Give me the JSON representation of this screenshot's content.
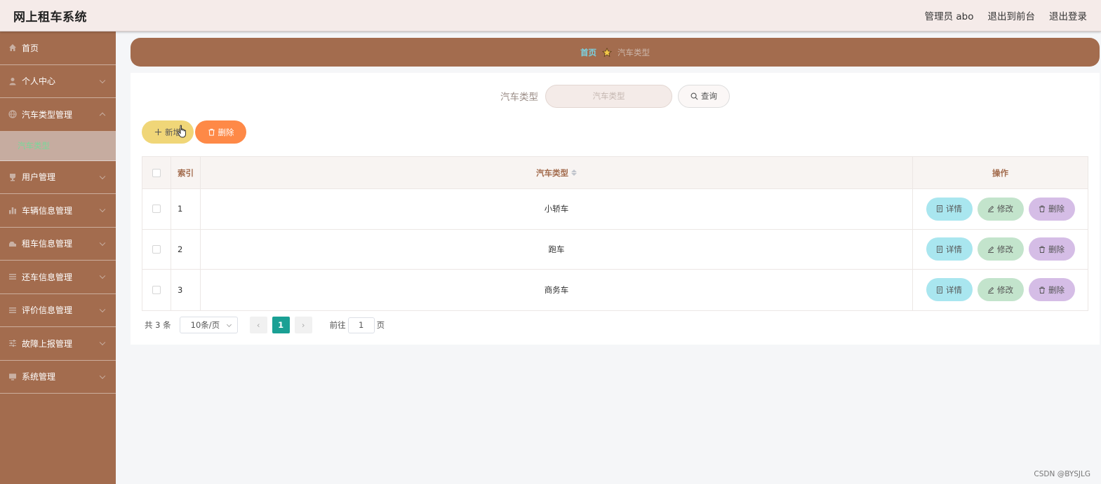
{
  "header": {
    "app_title": "网上租车系统",
    "admin_label": "管理员 abo",
    "back_to_front": "退出到前台",
    "logout": "退出登录"
  },
  "sidebar": {
    "items": [
      {
        "label": "首页",
        "icon": "home-icon"
      },
      {
        "label": "个人中心",
        "icon": "user-icon"
      },
      {
        "label": "汽车类型管理",
        "icon": "globe-icon",
        "expanded": true
      },
      {
        "label": "用户管理",
        "icon": "cup-icon"
      },
      {
        "label": "车辆信息管理",
        "icon": "bar-chart-icon"
      },
      {
        "label": "租车信息管理",
        "icon": "car-icon"
      },
      {
        "label": "还车信息管理",
        "icon": "list-icon"
      },
      {
        "label": "评价信息管理",
        "icon": "list-icon"
      },
      {
        "label": "故障上报管理",
        "icon": "sliders-icon"
      },
      {
        "label": "系统管理",
        "icon": "monitor-icon"
      }
    ],
    "subitem": "汽车类型"
  },
  "breadcrumb": {
    "home": "首页",
    "current": "汽车类型"
  },
  "search": {
    "label": "汽车类型",
    "placeholder": "汽车类型",
    "button": "查询"
  },
  "actions": {
    "add": "新增",
    "delete": "删除"
  },
  "table": {
    "headers": {
      "index": "索引",
      "type": "汽车类型",
      "ops": "操作"
    },
    "rows": [
      {
        "index": "1",
        "type": "小轿车"
      },
      {
        "index": "2",
        "type": "跑车"
      },
      {
        "index": "3",
        "type": "商务车"
      }
    ],
    "op_labels": {
      "detail": "详情",
      "edit": "修改",
      "delete": "删除"
    }
  },
  "pagination": {
    "total": "共 3 条",
    "page_size": "10条/页",
    "current_page": "1",
    "goto_label": "前往",
    "goto_value": "1",
    "page_suffix": "页",
    "prev": "‹",
    "next": "›"
  },
  "watermark": "CSDN @BYSJLG",
  "colors": {
    "sidebar_bg": "#a36c4e",
    "header_bg": "#f5ebe9",
    "add_btn": "#f0d678",
    "delete_btn": "#fe8947",
    "detail_btn": "#a9e6ef",
    "edit_btn": "#c3e4cc",
    "row_delete_btn": "#d5bde6",
    "active_page": "#1aa094",
    "submenu_text": "#79d79a"
  }
}
